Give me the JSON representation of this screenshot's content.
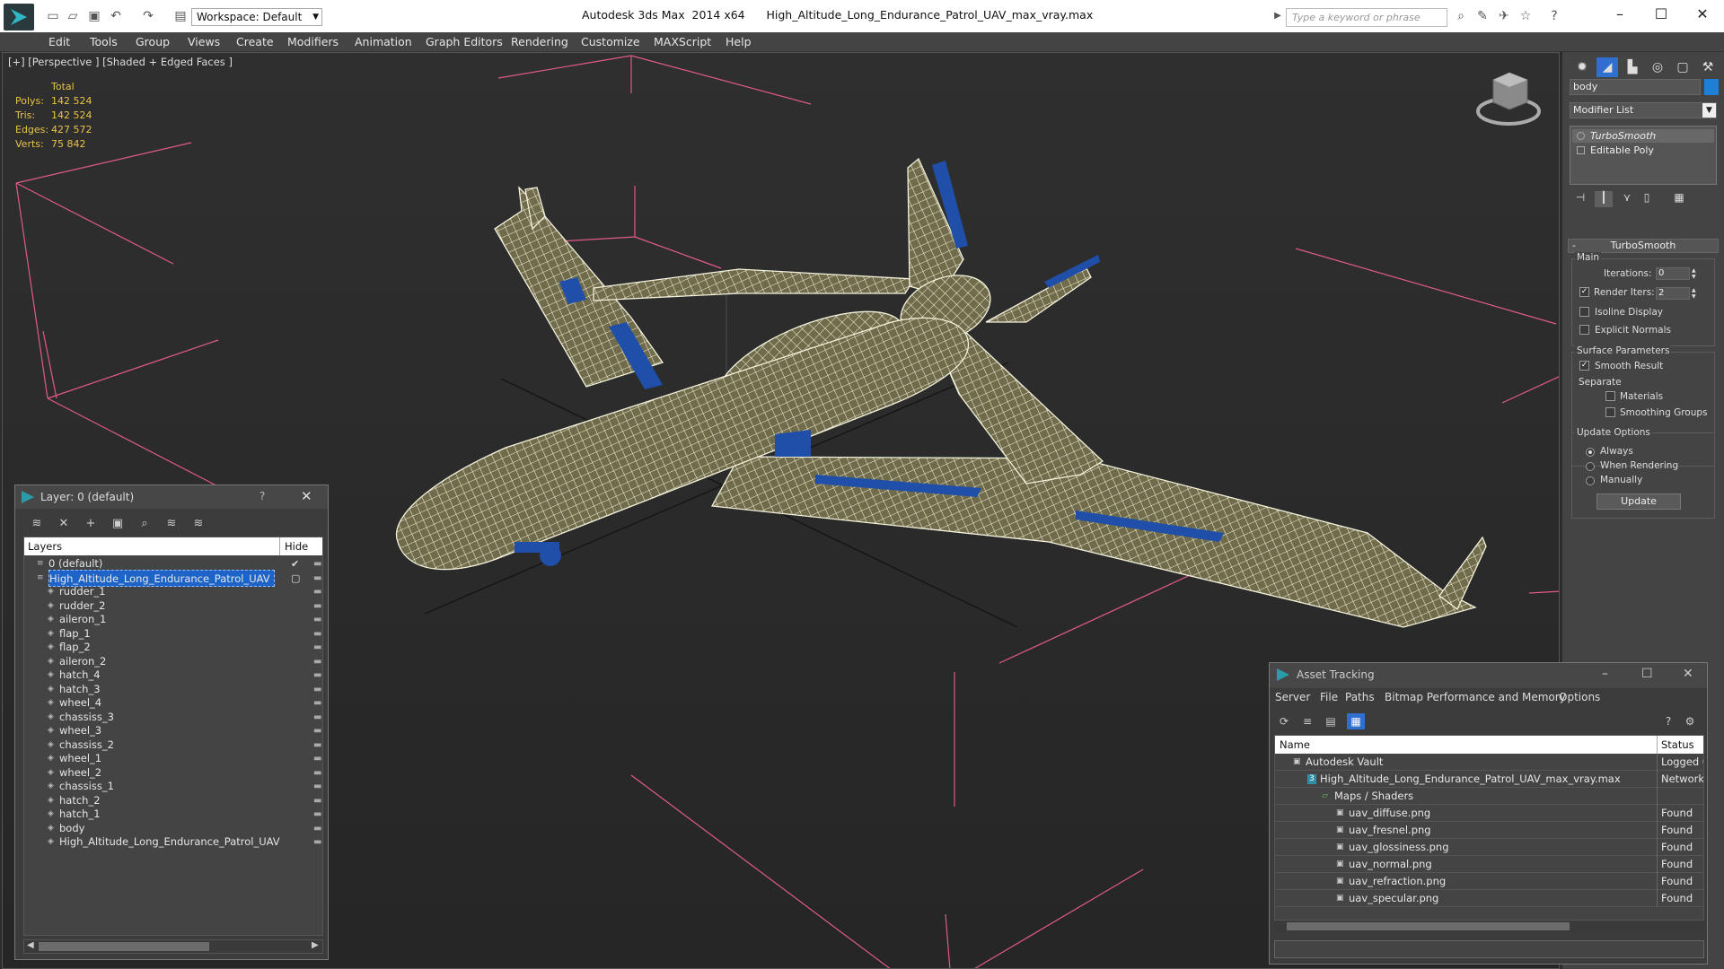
{
  "titlebar": {
    "app_title": "Autodesk 3ds Max  2014 x64",
    "file_title": "High_Altitude_Long_Endurance_Patrol_UAV_max_vray.max",
    "workspace_label": "Workspace: Default",
    "search_placeholder": "Type a keyword or phrase"
  },
  "menu": [
    "Edit",
    "Tools",
    "Group",
    "Views",
    "Create",
    "Modifiers",
    "Animation",
    "Graph Editors",
    "Rendering",
    "Customize",
    "MAXScript",
    "Help"
  ],
  "viewport": {
    "label": "[+] [Perspective ] [Shaded + Edged Faces ]",
    "stats": {
      "header": "Total",
      "polys_label": "Polys:",
      "polys": "142 524",
      "tris_label": "Tris:",
      "tris": "142 524",
      "edges_label": "Edges:",
      "edges": "427 572",
      "verts_label": "Verts:",
      "verts": "75 842"
    },
    "colors": {
      "grid": "#e05a8a",
      "mesh": "#f2f0d8",
      "accent_parts": "#1f4fa8"
    }
  },
  "command_panel": {
    "object_name": "body",
    "object_color": "#1f7fd4",
    "modifier_list_label": "Modifier List",
    "stack": [
      "TurboSmooth",
      "Editable Poly"
    ],
    "rollout_title": "TurboSmooth",
    "main_group": "Main",
    "iterations_label": "Iterations:",
    "iterations_value": "0",
    "render_iters_label": "Render Iters:",
    "render_iters_value": "2",
    "render_iters_checked": true,
    "isoline_label": "Isoline Display",
    "explicit_normals_label": "Explicit Normals",
    "surface_group": "Surface Parameters",
    "smooth_result_label": "Smooth Result",
    "separate_label": "Separate",
    "materials_label": "Materials",
    "smoothing_groups_label": "Smoothing Groups",
    "update_group": "Update Options",
    "always_label": "Always",
    "when_rendering_label": "When Rendering",
    "manually_label": "Manually",
    "update_button": "Update"
  },
  "layer_dialog": {
    "title": "Layer: 0 (default)",
    "help": "?",
    "col_layers": "Layers",
    "col_hide": "Hide",
    "rows": [
      {
        "name": "0 (default)",
        "level": 0,
        "kind": "layer"
      },
      {
        "name": "High_Altitude_Long_Endurance_Patrol_UAV",
        "level": 0,
        "kind": "layer"
      },
      {
        "name": "rudder_1",
        "level": 1,
        "kind": "object"
      },
      {
        "name": "rudder_2",
        "level": 1,
        "kind": "object"
      },
      {
        "name": "aileron_1",
        "level": 1,
        "kind": "object"
      },
      {
        "name": "flap_1",
        "level": 1,
        "kind": "object"
      },
      {
        "name": "flap_2",
        "level": 1,
        "kind": "object"
      },
      {
        "name": "aileron_2",
        "level": 1,
        "kind": "object"
      },
      {
        "name": "hatch_4",
        "level": 1,
        "kind": "object"
      },
      {
        "name": "hatch_3",
        "level": 1,
        "kind": "object"
      },
      {
        "name": "wheel_4",
        "level": 1,
        "kind": "object"
      },
      {
        "name": "chassiss_3",
        "level": 1,
        "kind": "object"
      },
      {
        "name": "wheel_3",
        "level": 1,
        "kind": "object"
      },
      {
        "name": "chassiss_2",
        "level": 1,
        "kind": "object"
      },
      {
        "name": "wheel_1",
        "level": 1,
        "kind": "object"
      },
      {
        "name": "wheel_2",
        "level": 1,
        "kind": "object"
      },
      {
        "name": "chassiss_1",
        "level": 1,
        "kind": "object"
      },
      {
        "name": "hatch_2",
        "level": 1,
        "kind": "object"
      },
      {
        "name": "hatch_1",
        "level": 1,
        "kind": "object"
      },
      {
        "name": "body",
        "level": 1,
        "kind": "object"
      },
      {
        "name": "High_Altitude_Long_Endurance_Patrol_UAV",
        "level": 1,
        "kind": "object"
      }
    ]
  },
  "asset_dialog": {
    "title": "Asset Tracking",
    "menu": [
      "Server",
      "File",
      "Paths",
      "Bitmap Performance and Memory",
      "Options"
    ],
    "col_name": "Name",
    "col_status": "Status",
    "rows": [
      {
        "name": "Autodesk Vault",
        "level": 0,
        "status": "Logged O"
      },
      {
        "name": "High_Altitude_Long_Endurance_Patrol_UAV_max_vray.max",
        "level": 1,
        "status": "Network F"
      },
      {
        "name": "Maps / Shaders",
        "level": 2,
        "status": ""
      },
      {
        "name": "uav_diffuse.png",
        "level": 3,
        "status": "Found"
      },
      {
        "name": "uav_fresnel.png",
        "level": 3,
        "status": "Found"
      },
      {
        "name": "uav_glossiness.png",
        "level": 3,
        "status": "Found"
      },
      {
        "name": "uav_normal.png",
        "level": 3,
        "status": "Found"
      },
      {
        "name": "uav_refraction.png",
        "level": 3,
        "status": "Found"
      },
      {
        "name": "uav_specular.png",
        "level": 3,
        "status": "Found"
      }
    ]
  }
}
